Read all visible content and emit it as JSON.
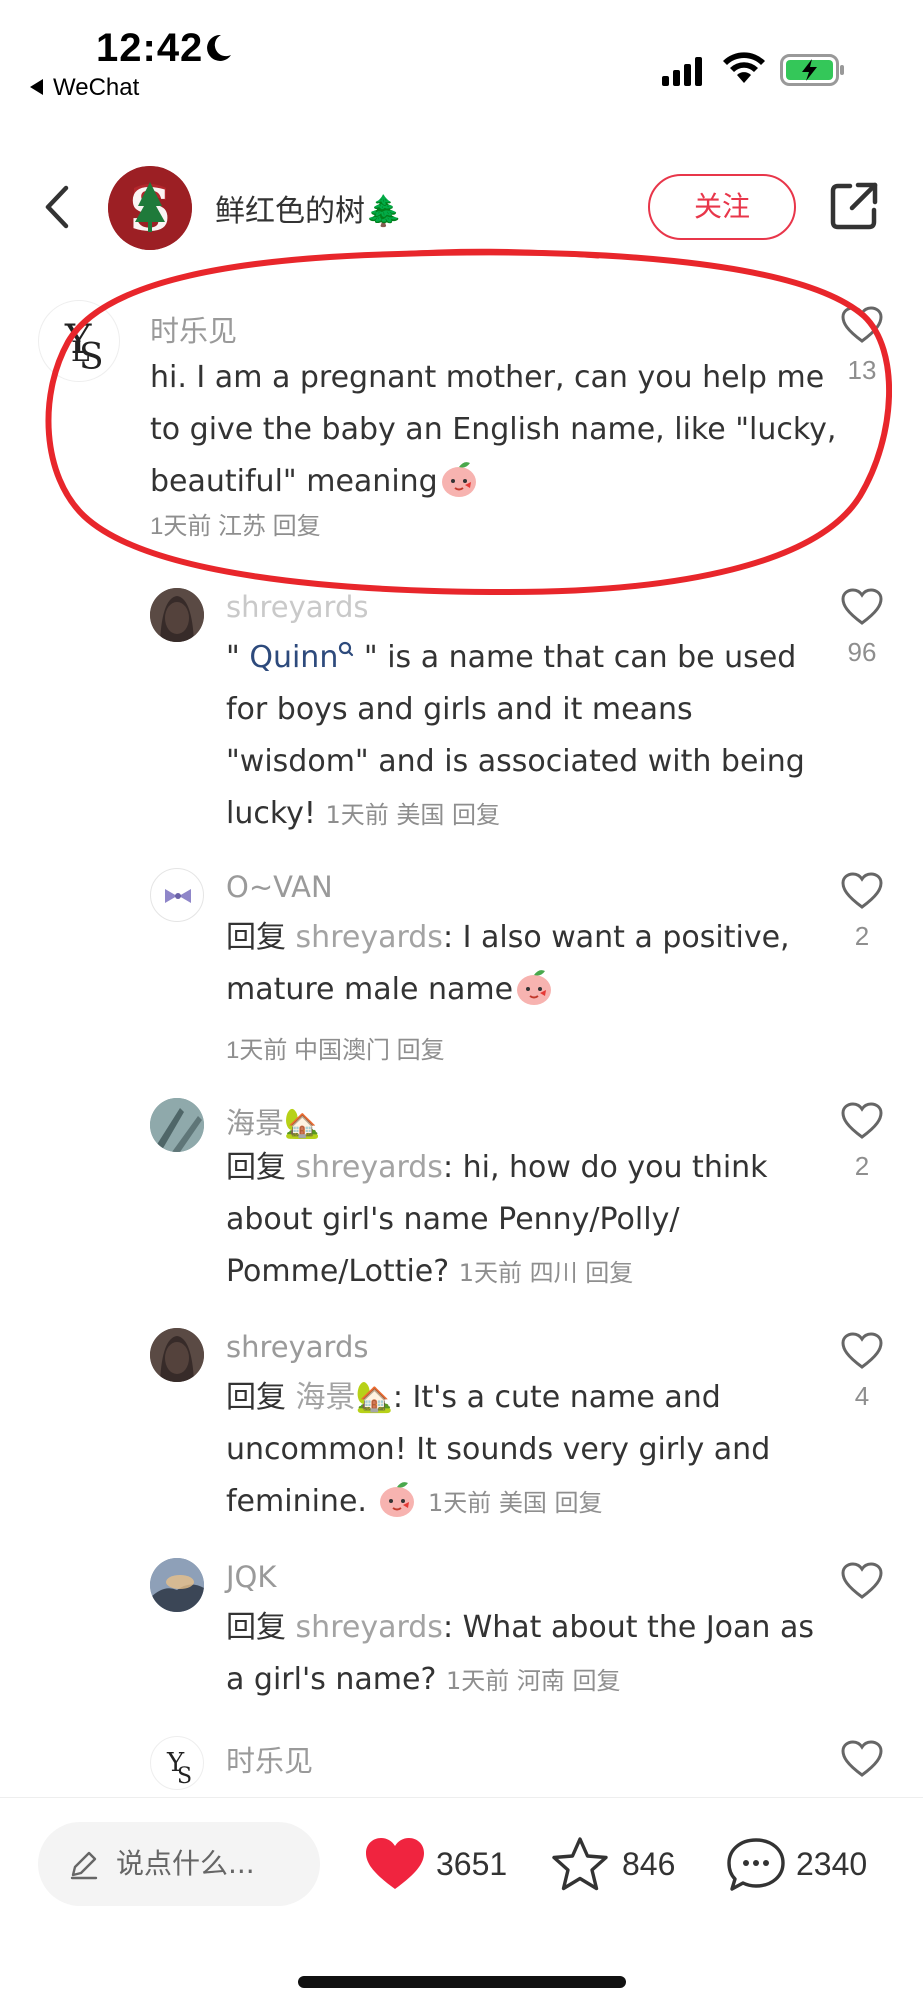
{
  "status_bar": {
    "time": "12:42",
    "back_app": "WeChat"
  },
  "header": {
    "author_name": "鲜红色的树🌲",
    "follow_label": "关注"
  },
  "comments": [
    {
      "user": "时乐见",
      "text": "hi. I am a pregnant mother, can you help me to give the baby an English name, like \"lucky, beautiful\" meaning",
      "meta": "1天前 江苏 回复",
      "likes": "13"
    },
    {
      "user": "shreyards",
      "text_prefix": "\" ",
      "link_name": "Quinn",
      "text": " \" is a name that can be used for boys and girls and it means \"wisdom\" and is associated with being lucky!",
      "meta": "1天前 美国 回复",
      "likes": "96"
    },
    {
      "user": "O~VAN",
      "reply_label": "回复",
      "reply_target": "shreyards",
      "text": ": I also want a positive, mature male name",
      "meta": "1天前 中国澳门 回复",
      "likes": "2"
    },
    {
      "user": "海景🏡",
      "reply_label": "回复",
      "reply_target": "shreyards",
      "text": ": hi, how do you think about girl's name Penny/Polly/ Pomme/Lottie?",
      "meta": "1天前 四川 回复",
      "likes": "2"
    },
    {
      "user": "shreyards",
      "reply_label": "回复",
      "reply_target": "海景🏡",
      "text": ": It's a cute name and uncommon! It sounds very girly and feminine.",
      "meta": "1天前 美国 回复",
      "likes": "4"
    },
    {
      "user": "JQK",
      "reply_label": "回复",
      "reply_target": "shreyards",
      "text": ": What about the Joan as a girl's name?",
      "meta": "1天前 河南 回复",
      "likes": ""
    },
    {
      "user": "时乐见",
      "likes": ""
    }
  ],
  "bottom_bar": {
    "input_placeholder": "说点什么...",
    "likes": "3651",
    "favorites": "846",
    "comments": "2340"
  },
  "colors": {
    "accent": "#e8364a",
    "highlight_ring": "#e8262b",
    "link": "#2d4a7c"
  },
  "icons": [
    "moon-icon",
    "signal-icon",
    "wifi-icon",
    "battery-charging-icon",
    "back-chevron-icon",
    "share-icon",
    "heart-outline-icon",
    "heart-filled-icon",
    "star-icon",
    "comment-bubble-icon",
    "pen-icon",
    "peach-emoji",
    "house-tree-emoji"
  ]
}
